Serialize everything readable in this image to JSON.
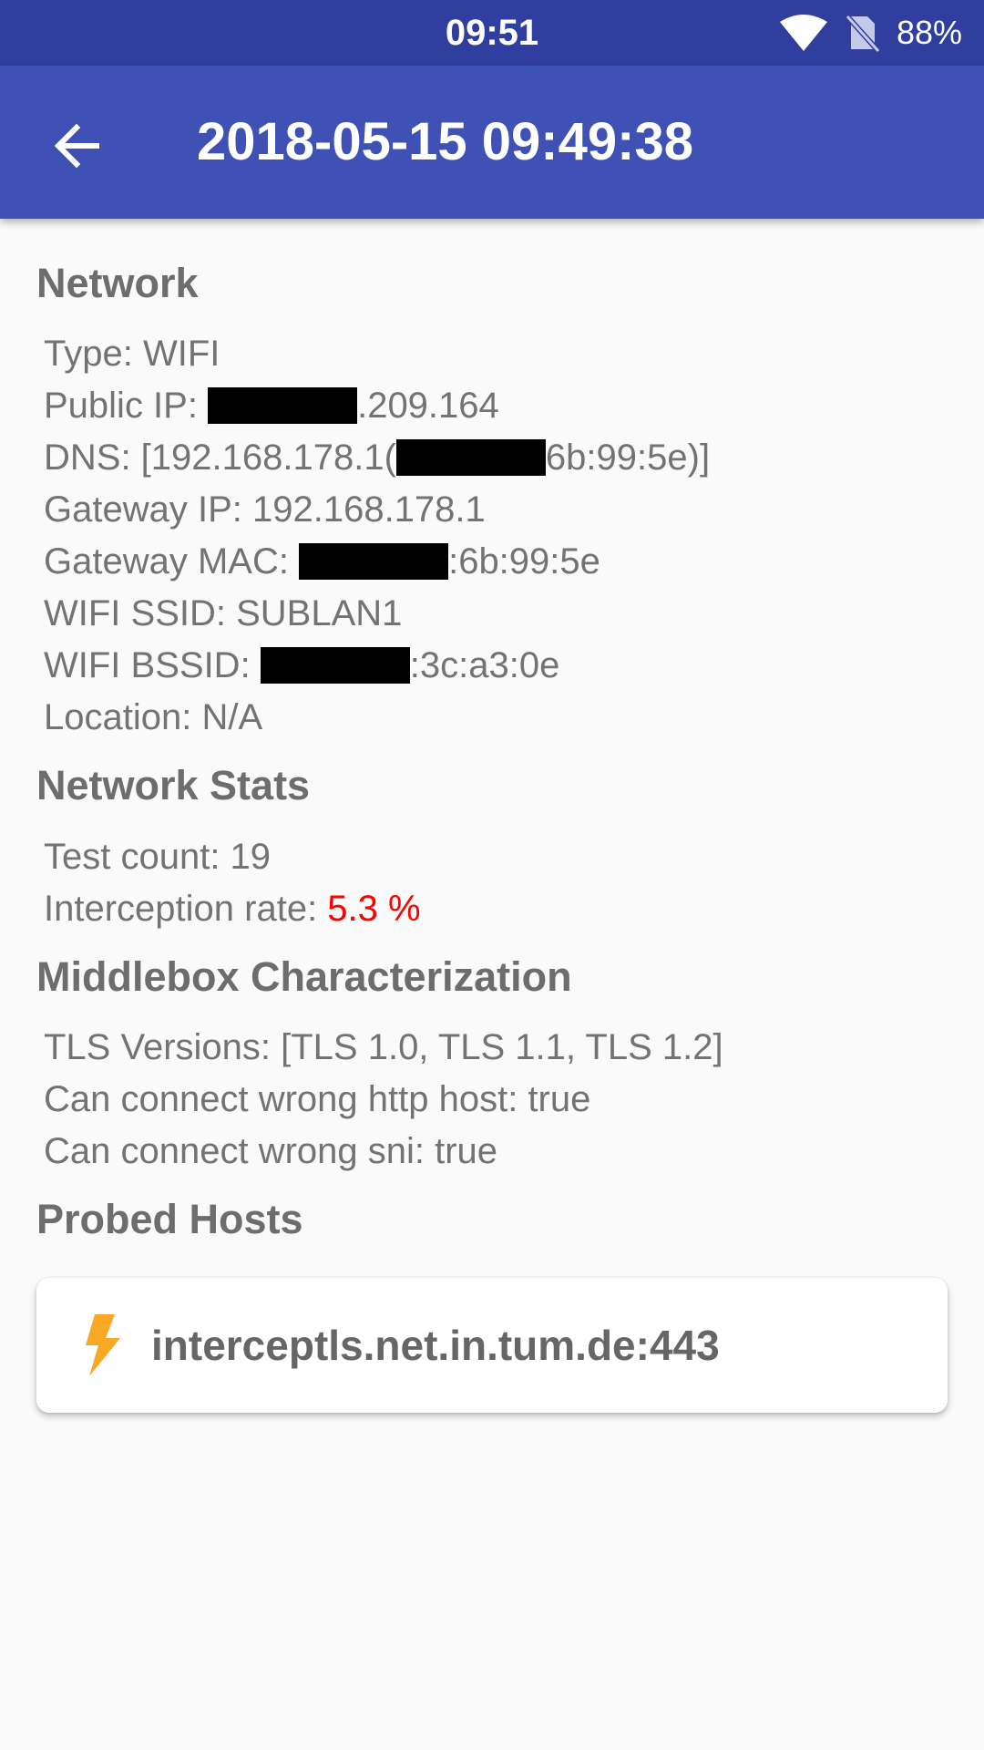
{
  "status_bar": {
    "time": "09:51",
    "battery": "88%",
    "icons": [
      "wifi-icon",
      "no-sim-icon"
    ]
  },
  "app_bar": {
    "back_icon": "arrow-back-icon",
    "title": "2018-05-15 09:49:38"
  },
  "network": {
    "title": "Network",
    "type": "Type: WIFI",
    "public_ip_label": "Public IP: ",
    "public_ip_suffix": ".209.164",
    "dns_label": "DNS: [192.168.178.1(",
    "dns_suffix": "6b:99:5e)]",
    "gateway_ip": "Gateway IP: 192.168.178.1",
    "gateway_mac_label": "Gateway MAC: ",
    "gateway_mac_suffix": ":6b:99:5e",
    "wifi_ssid": "WIFI SSID: SUBLAN1",
    "wifi_bssid_label": "WIFI BSSID: ",
    "wifi_bssid_suffix": ":3c:a3:0e",
    "location": "Location: N/A"
  },
  "network_stats": {
    "title": "Network Stats",
    "test_count": "Test count: 19",
    "interception_label": "Interception rate: ",
    "interception_value": "5.3 %"
  },
  "middlebox": {
    "title": "Middlebox Characterization",
    "tls_versions": "TLS Versions: [TLS 1.0, TLS 1.1, TLS 1.2]",
    "wrong_http_host": "Can connect wrong http host: true",
    "wrong_sni": "Can connect wrong sni: true"
  },
  "probed_hosts": {
    "title": "Probed Hosts",
    "items": [
      {
        "icon": "lightning-bolt-icon",
        "host": "interceptls.net.in.tum.de:443"
      }
    ]
  },
  "colors": {
    "status_bar": "#303f9f",
    "app_bar": "#3f51b5",
    "interception_rate": "#ff0000",
    "bolt": "#f9a825"
  }
}
